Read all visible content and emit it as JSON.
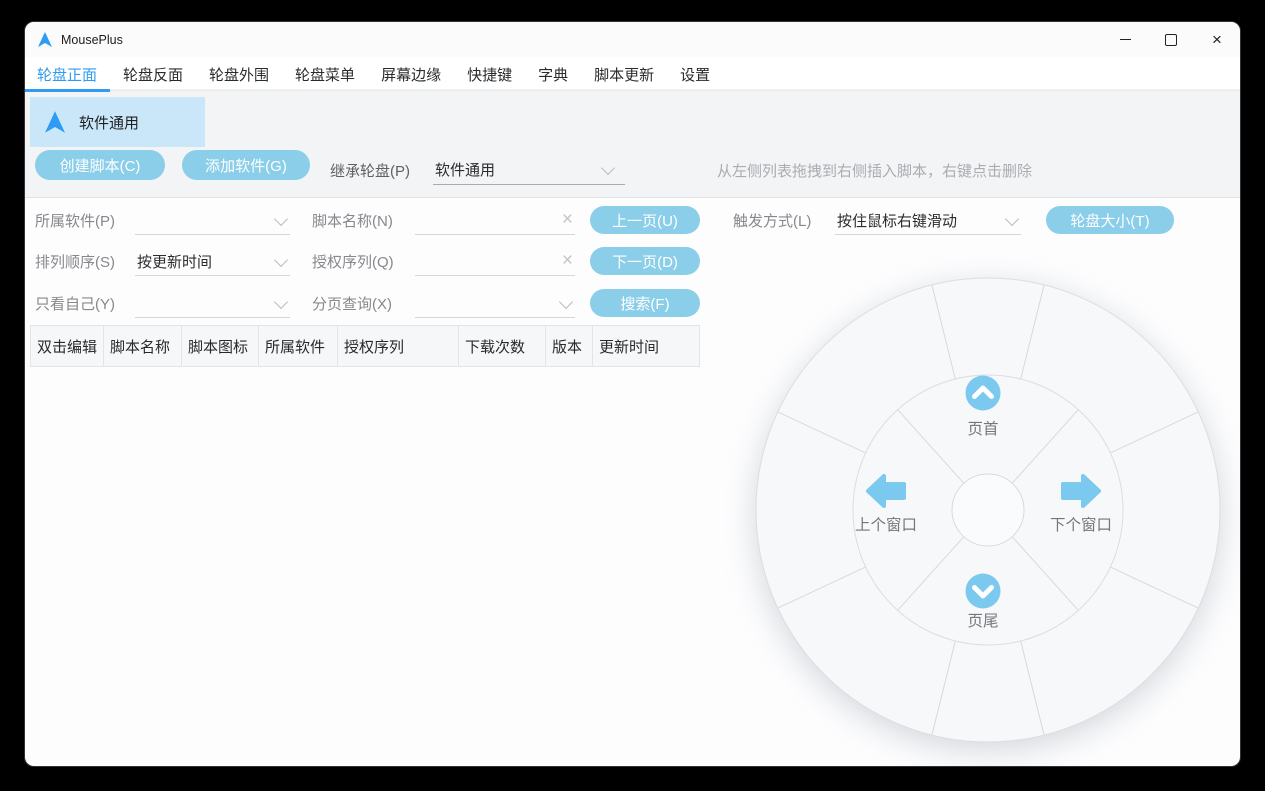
{
  "app": {
    "title": "MousePlus"
  },
  "tabs": {
    "items": [
      {
        "label": "轮盘正面",
        "active": true
      },
      {
        "label": "轮盘反面",
        "active": false
      },
      {
        "label": "轮盘外围",
        "active": false
      },
      {
        "label": "轮盘菜单",
        "active": false
      },
      {
        "label": "屏幕边缘",
        "active": false
      },
      {
        "label": "快捷键",
        "active": false
      },
      {
        "label": "字典",
        "active": false
      },
      {
        "label": "脚本更新",
        "active": false
      },
      {
        "label": "设置",
        "active": false
      }
    ]
  },
  "wheel_tab": {
    "label": "软件通用"
  },
  "toolbar": {
    "create_script": "创建脚本(C)",
    "add_software": "添加软件(G)",
    "inherit_label": "继承轮盘(P)",
    "inherit_value": "软件通用",
    "hint": "从左侧列表拖拽到右侧插入脚本，右键点击删除"
  },
  "filters": {
    "software_label": "所属软件(P)",
    "software_value": "",
    "script_name_label": "脚本名称(N)",
    "script_name_value": "",
    "order_label": "排列顺序(S)",
    "order_value": "按更新时间",
    "license_label": "授权序列(Q)",
    "license_value": "",
    "own_label": "只看自己(Y)",
    "own_value": "",
    "paging_label": "分页查询(X)",
    "paging_value": "",
    "prev_page": "上一页(U)",
    "next_page": "下一页(D)",
    "search": "搜索(F)",
    "trigger_label": "触发方式(L)",
    "trigger_value": "按住鼠标右键滑动",
    "wheel_size": "轮盘大小(T)"
  },
  "table": {
    "columns": [
      "双击编辑",
      "脚本名称",
      "脚本图标",
      "所属软件",
      "授权序列",
      "下载次数",
      "版本",
      "更新时间"
    ],
    "rows": []
  },
  "wheel": {
    "up_label": "页首",
    "down_label": "页尾",
    "left_label": "上个窗口",
    "right_label": "下个窗口"
  },
  "colors": {
    "accent_blue": "#2e9cf4",
    "button_blue": "#8bcee9",
    "wheel_icon_blue": "#7cc9ef",
    "highlight_bg": "#c9e7f8"
  }
}
